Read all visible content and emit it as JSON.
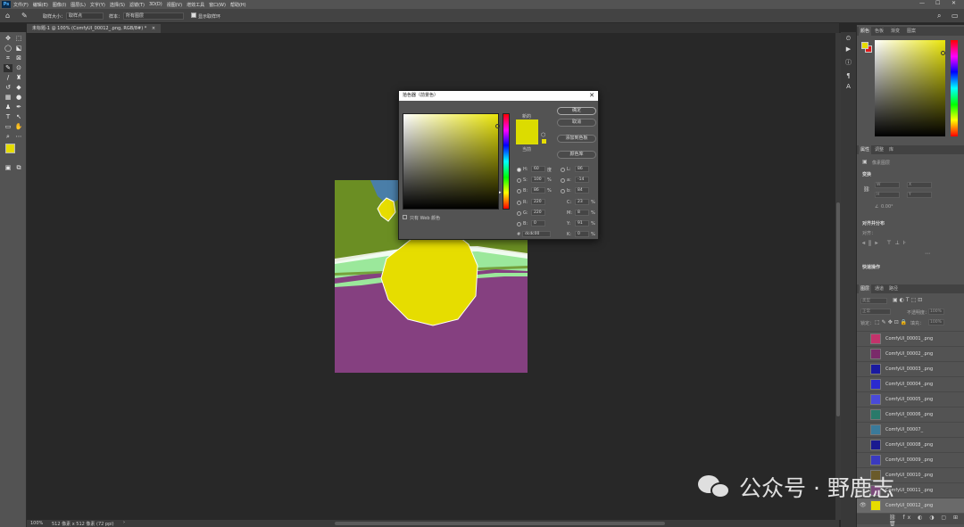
{
  "menubar": {
    "logo": "Ps",
    "items": [
      "文件(F)",
      "编辑(E)",
      "图像(I)",
      "图层(L)",
      "文字(Y)",
      "选择(S)",
      "滤镜(T)",
      "3D(D)",
      "视图(V)",
      "增效工具",
      "窗口(W)",
      "帮助(H)"
    ],
    "window_controls": [
      "—",
      "☐",
      "✕"
    ]
  },
  "options": {
    "sample_size_label": "取样大小：",
    "sample_size_value": "取样点",
    "sample_label": "样本：",
    "sample_value": "所有图层",
    "show_ring_label": "显示取样环"
  },
  "document": {
    "tab_title": "未标题-1 @ 100% (ComfyUI_00012_.png, RGB/8#) *",
    "tab_close": "×"
  },
  "status": {
    "zoom": "100%",
    "size": "512 像素 x 512 像素 (72 ppi)"
  },
  "color_panel": {
    "tabs": [
      "颜色",
      "色板",
      "渐变",
      "图案"
    ]
  },
  "properties_panel": {
    "tabs": [
      "属性",
      "调整",
      "库"
    ],
    "doc_label": "像素图层",
    "transform_title": "变换",
    "w_placeholder": "W",
    "h_placeholder": "H",
    "x_placeholder": "X",
    "y_placeholder": "Y",
    "angle_value": "0.00°",
    "align_title": "对齐并分布",
    "align_label": "对齐：",
    "quick_title": "快速操作"
  },
  "layers_panel": {
    "tabs": [
      "图层",
      "通道",
      "路径"
    ],
    "search_placeholder": "类型",
    "blend_mode": "正常",
    "opacity_label": "不透明度：",
    "opacity_value": "100%",
    "lock_label": "锁定：",
    "fill_label": "填充：",
    "fill_value": "100%",
    "layers": [
      {
        "name": "ComfyUI_00001_.png",
        "thumb": "#c2336b"
      },
      {
        "name": "ComfyUI_00002_.png",
        "thumb": "#7a2a6a"
      },
      {
        "name": "ComfyUI_00003_.png",
        "thumb": "#1a1aa0"
      },
      {
        "name": "ComfyUI_00004_.png",
        "thumb": "#2a2ad0"
      },
      {
        "name": "ComfyUI_00005_.png",
        "thumb": "#4a4ad8"
      },
      {
        "name": "ComfyUI_00006_.png",
        "thumb": "#2a7a6a"
      },
      {
        "name": "ComfyUI_00007_",
        "thumb": "#3a7a9a"
      },
      {
        "name": "ComfyUI_00008_.png",
        "thumb": "#1a1a90"
      },
      {
        "name": "ComfyUI_00009_.png",
        "thumb": "#3a3ac0"
      },
      {
        "name": "ComfyUI_00010_.png",
        "thumb": "#6a5a2a"
      },
      {
        "name": "ComfyUI_00011_.png",
        "thumb": "#7a4a7a"
      },
      {
        "name": "ComfyUI_00012_.png",
        "thumb": "#e6dd00"
      }
    ]
  },
  "picker": {
    "title": "拾色器（前景色）",
    "close": "✕",
    "new_label": "新的",
    "current_label": "当前",
    "ok": "确定",
    "cancel": "取消",
    "add_swatch": "添加到色板",
    "libraries": "颜色库",
    "web_only": "只有 Web 颜色",
    "new_color": "#dcdc00",
    "current_color": "#dcdc00",
    "fields": {
      "H": {
        "value": "60",
        "unit": "度"
      },
      "S": {
        "value": "100",
        "unit": "%"
      },
      "B": {
        "value": "86",
        "unit": "%"
      },
      "R": {
        "value": "220"
      },
      "G": {
        "value": "220"
      },
      "Bv": {
        "value": "0"
      },
      "L": {
        "value": "86"
      },
      "a": {
        "value": "-14"
      },
      "b": {
        "value": "84"
      },
      "C": {
        "value": "23",
        "unit": "%"
      },
      "M": {
        "value": "8",
        "unit": "%"
      },
      "Y": {
        "value": "91",
        "unit": "%"
      },
      "K": {
        "value": "0",
        "unit": "%"
      },
      "hex": "dcdc00"
    }
  },
  "watermark": {
    "text": "公众号 · 野鹿志"
  },
  "colors": {
    "foreground": "#e6dd00",
    "background": "#e01a1a"
  }
}
